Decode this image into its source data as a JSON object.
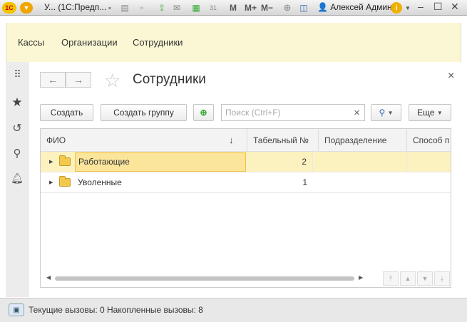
{
  "titlebar": {
    "logo": "1С",
    "app_title": "У... (1С:Предп...",
    "m1": "M",
    "m_plus": "M+",
    "m_minus": "M−",
    "user": "Алексей Админ",
    "info": "i"
  },
  "sections": [
    "Кассы",
    "Организации",
    "Сотрудники"
  ],
  "form": {
    "title": "Сотрудники",
    "toolbar": {
      "create": "Создать",
      "create_group": "Создать группу",
      "search_placeholder": "Поиск (Ctrl+F)",
      "more": "Еще"
    },
    "columns": [
      "ФИО",
      "Табельный №",
      "Подразделение",
      "Способ п"
    ],
    "rows": [
      {
        "name": "Работающие",
        "number": "2",
        "selected": true
      },
      {
        "name": "Уволенные",
        "number": "1",
        "selected": false
      }
    ]
  },
  "status": {
    "text": "Текущие вызовы: 0   Накопленные вызовы: 8"
  },
  "icons": [
    "menu-icon",
    "star-icon",
    "history-icon",
    "search-icon",
    "bell-icon",
    "back-arrow-icon",
    "forward-arrow-icon",
    "close-icon",
    "folder-icon",
    "expand-arrow-icon",
    "sort-down-icon"
  ],
  "colors": {
    "section_bg": "#fbf7d4",
    "selected_row": "#fcf2c0",
    "focus_cell": "#fbe59a"
  }
}
